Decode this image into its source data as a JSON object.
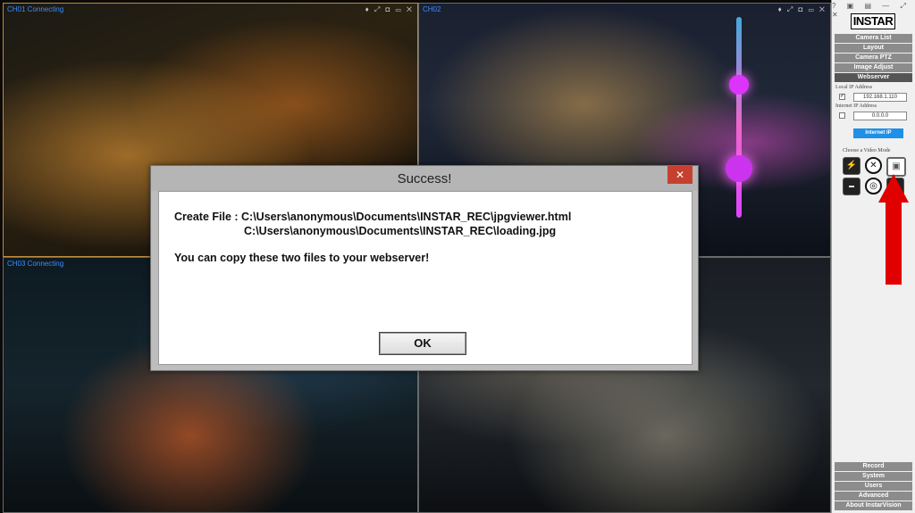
{
  "cameras": [
    {
      "label": "CH01 Connecting",
      "tools": "♦ ⤢ ◘ ▭ ✕"
    },
    {
      "label": "CH02",
      "tools": "♦ ⤢ ◘ ▭ ✕"
    },
    {
      "label": "CH03 Connecting",
      "tools": ""
    },
    {
      "label": "",
      "tools": ""
    }
  ],
  "window_controls": "? ▣ ▤ — ⤢ ✕",
  "sidebar": {
    "logo": "INSTAR",
    "top_nav": [
      "Camera List",
      "Layout",
      "Camera PTZ",
      "Image Adjust",
      "Webserver"
    ],
    "local_ip_label": "Local IP Address",
    "local_ip": "192.168.1.110",
    "local_ip_checked": "✓",
    "internet_ip_label": "Internet IP Address",
    "internet_ip": "0.0.0.0",
    "internet_ip_button": "Internet IP",
    "video_mode_label": "Choose a Video Mode",
    "bottom_nav": [
      "Record",
      "System",
      "Users",
      "Advanced",
      "About InstarVision"
    ]
  },
  "dialog": {
    "title": "Success!",
    "close": "✕",
    "line1": "Create File : C:\\Users\\anonymous\\Documents\\INSTAR_REC\\jpgviewer.html",
    "line2": "C:\\Users\\anonymous\\Documents\\INSTAR_REC\\loading.jpg",
    "line3": "You can copy these two files to your webserver!",
    "ok": "OK"
  },
  "colors": {
    "accent": "#1e90e8",
    "arrow": "#e00000",
    "close": "#c7402f"
  }
}
